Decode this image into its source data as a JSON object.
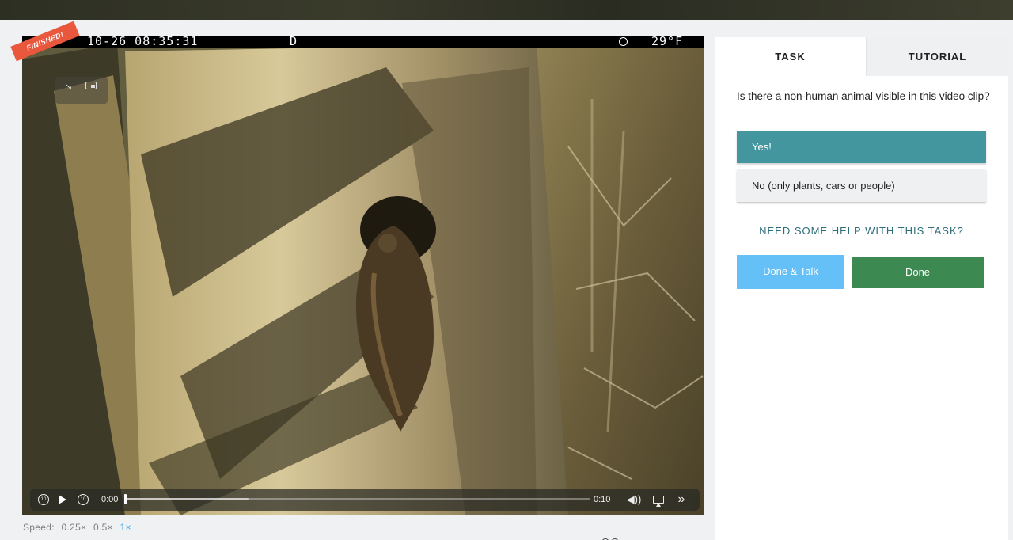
{
  "video": {
    "ribbon_label": "FINISHED!",
    "osd": {
      "timestamp": "10-26 08:35:31",
      "mode": "D",
      "temperature": "29°F"
    },
    "controls": {
      "current_time": "0:00",
      "duration": "0:10",
      "skip_back_label": "10",
      "skip_forward_label": "10",
      "progress": 0.0
    },
    "speed": {
      "label": "Speed:",
      "options": [
        "0.25×",
        "0.5×",
        "1×"
      ],
      "selected": "1×"
    }
  },
  "panel": {
    "tabs": [
      {
        "label": "TASK",
        "active": true
      },
      {
        "label": "TUTORIAL",
        "active": false
      }
    ],
    "question": "Is there a non-human animal visible in this video clip?",
    "answers": [
      {
        "label": "Yes!",
        "selected": true
      },
      {
        "label": "No (only plants, cars or people)",
        "selected": false
      }
    ],
    "help_link": "NEED SOME HELP WITH THIS TASK?",
    "buttons": {
      "done_talk": "Done & Talk",
      "done": "Done"
    }
  },
  "colors": {
    "selected_answer": "#43959e",
    "done_talk": "#64c0f6",
    "done": "#3c8a52",
    "ribbon": "#e9573d",
    "speed_active": "#43a5e8"
  }
}
